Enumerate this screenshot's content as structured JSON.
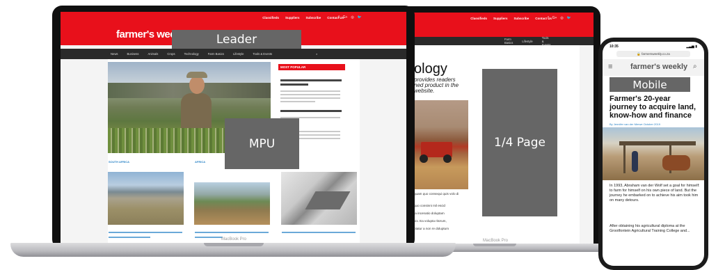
{
  "site": {
    "nav_links": [
      "Classifieds",
      "Suppliers",
      "Subscribe",
      "Contact Us"
    ],
    "social": [
      "f",
      "G+",
      "◎",
      "🐦"
    ],
    "menu": [
      "News",
      "Business",
      "Animals",
      "Crops",
      "Technology",
      "Farm Basics",
      "Lifestyle",
      "Tools & Events"
    ],
    "logo_text": "farmer's weekly",
    "most_popular": "MOST POPULAR",
    "sections": [
      "SOUTH AFRICA",
      "AFRICA"
    ],
    "tablet_heading_fragment": "ology",
    "tablet_intro_fragment": "provides readers\nned product in the\nwebsite.",
    "body_fragments": [
      "quam quo consequi quis volo di",
      "quo consinni mil escid",
      "ta incenatio doluptam",
      "vix. Ea volupta ritorum,",
      "ptatur a non re doluptum"
    ]
  },
  "ads": {
    "leader": "Leader",
    "mpu": "MPU",
    "page": "1/4 Page",
    "mobile": "Mobile"
  },
  "devices": {
    "laptop_label": "MacBook Pro",
    "laptop2_label": "MacBook Pro"
  },
  "phone": {
    "time": "10:35",
    "url": "farmersweekly.co.za",
    "logo_text": "farmer's weekly",
    "headline": "Farmer's 20-year journey to acquire land, know-how and finance",
    "byline": "By Jennifer van der Merwe  October 2019",
    "para1": "In 1993, Abraham van der Wolf set a goal for himself: to farm for himself on his own piece of land. But the journey he embarked on to achieve his aim took him on many detours.",
    "para2": "After obtaining his agricultural diploma at the Grootfontein Agricultural Training College and..."
  }
}
